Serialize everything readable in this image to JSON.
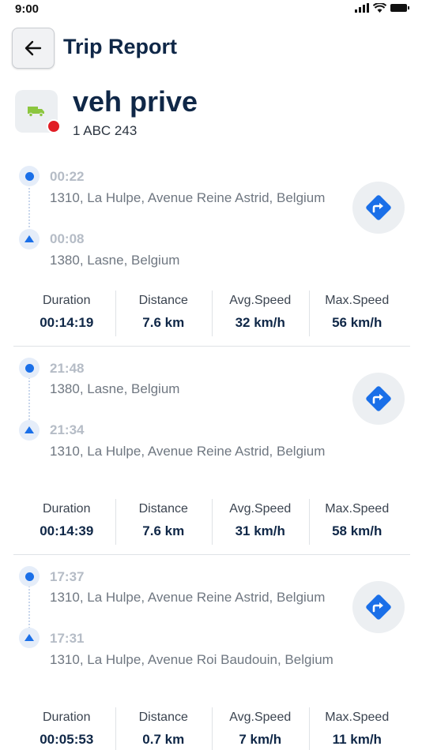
{
  "status_bar": {
    "time": "9:00"
  },
  "header": {
    "title": "Trip Report"
  },
  "vehicle": {
    "name": "veh prive",
    "plate": "1 ABC 243"
  },
  "stat_labels": {
    "duration": "Duration",
    "distance": "Distance",
    "avg_speed": "Avg.Speed",
    "max_speed": "Max.Speed"
  },
  "trips": [
    {
      "end_time": "00:22",
      "end_address": "1310, La Hulpe, Avenue Reine Astrid, Belgium",
      "start_time": "00:08",
      "start_address": "1380, Lasne, Belgium",
      "duration": "00:14:19",
      "distance": "7.6 km",
      "avg_speed": "32 km/h",
      "max_speed": "56 km/h"
    },
    {
      "end_time": "21:48",
      "end_address": "1380, Lasne, Belgium",
      "start_time": "21:34",
      "start_address": "1310, La Hulpe, Avenue Reine Astrid, Belgium",
      "duration": "00:14:39",
      "distance": "7.6 km",
      "avg_speed": "31 km/h",
      "max_speed": "58 km/h"
    },
    {
      "end_time": "17:37",
      "end_address": "1310, La Hulpe, Avenue Reine Astrid, Belgium",
      "start_time": "17:31",
      "start_address": "1310, La Hulpe, Avenue Roi Baudouin, Belgium",
      "duration": "00:05:53",
      "distance": "0.7 km",
      "avg_speed": "7 km/h",
      "max_speed": "11 km/h"
    }
  ],
  "colors": {
    "accent": "#1a6fe8",
    "title": "#0f2747",
    "status_dot": "#e11d25",
    "vehicle_icon": "#8cc63f"
  },
  "icons": {
    "back": "arrow-left-icon",
    "vehicle": "truck-icon",
    "navigate": "directions-icon",
    "start": "dot-icon",
    "end": "triangle-icon",
    "signal": "signal-icon",
    "wifi": "wifi-icon",
    "battery": "battery-icon"
  }
}
